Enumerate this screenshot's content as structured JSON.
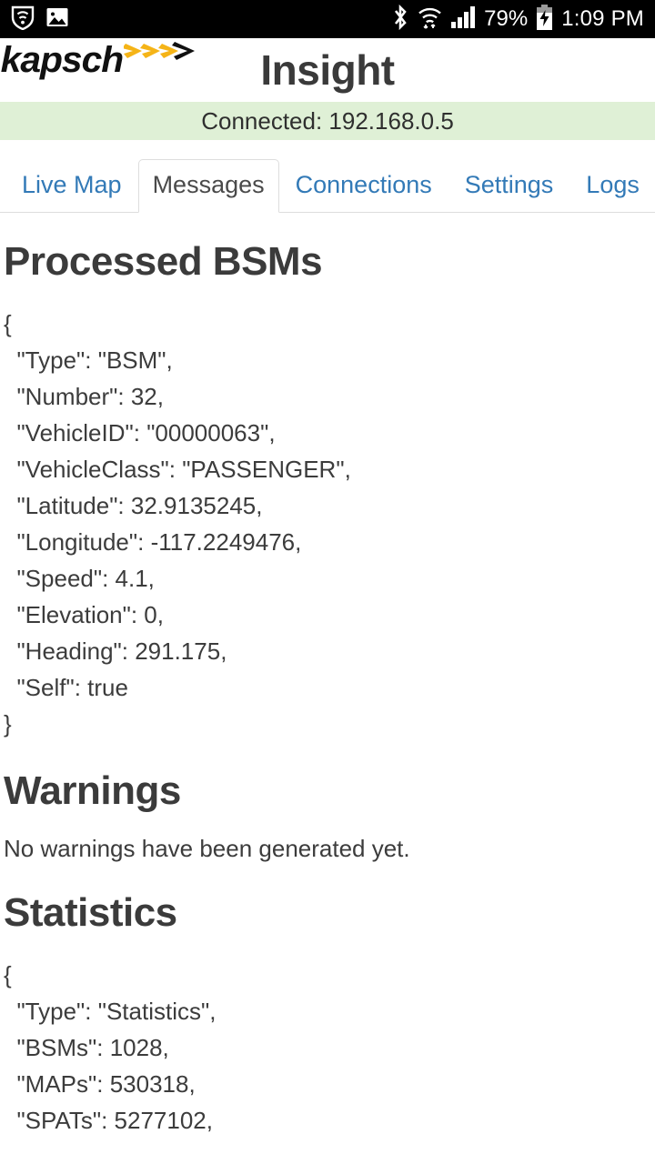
{
  "status_bar": {
    "left_icons": [
      "security-shield-icon",
      "screenshot-image-icon"
    ],
    "right_icons": [
      "bluetooth-icon",
      "wifi-icon",
      "cellular-signal-icon",
      "battery-charging-icon"
    ],
    "battery_percent": "79%",
    "clock": "1:09 PM"
  },
  "header": {
    "logo_word": "kapsch",
    "logo_chevrons": ">>>",
    "title": "Insight"
  },
  "banner": {
    "text": "Connected: 192.168.0.5",
    "background": "#dff0d6"
  },
  "tabs": {
    "items": [
      {
        "label": "Live Map",
        "active": false
      },
      {
        "label": "Messages",
        "active": true
      },
      {
        "label": "Connections",
        "active": false
      },
      {
        "label": "Settings",
        "active": false
      },
      {
        "label": "Logs",
        "active": false
      }
    ],
    "link_color": "#337ab7",
    "active_color": "#4a4a4a"
  },
  "main": {
    "processed_bsms": {
      "heading": "Processed BSMs",
      "json_text": "{\n  \"Type\": \"BSM\",\n  \"Number\": 32,\n  \"VehicleID\": \"00000063\",\n  \"VehicleClass\": \"PASSENGER\",\n  \"Latitude\": 32.9135245,\n  \"Longitude\": -117.2249476,\n  \"Speed\": 4.1,\n  \"Elevation\": 0,\n  \"Heading\": 291.175,\n  \"Self\": true\n}",
      "fields": {
        "Type": "BSM",
        "Number": 32,
        "VehicleID": "00000063",
        "VehicleClass": "PASSENGER",
        "Latitude": 32.9135245,
        "Longitude": -117.2249476,
        "Speed": 4.1,
        "Elevation": 0,
        "Heading": 291.175,
        "Self": true
      }
    },
    "warnings": {
      "heading": "Warnings",
      "text": "No warnings have been generated yet."
    },
    "statistics": {
      "heading": "Statistics",
      "json_text": "{\n  \"Type\": \"Statistics\",\n  \"BSMs\": 1028,\n  \"MAPs\": 530318,\n  \"SPATs\": 5277102,",
      "fields": {
        "Type": "Statistics",
        "BSMs": 1028,
        "MAPs": 530318,
        "SPATs": 5277102
      }
    }
  }
}
